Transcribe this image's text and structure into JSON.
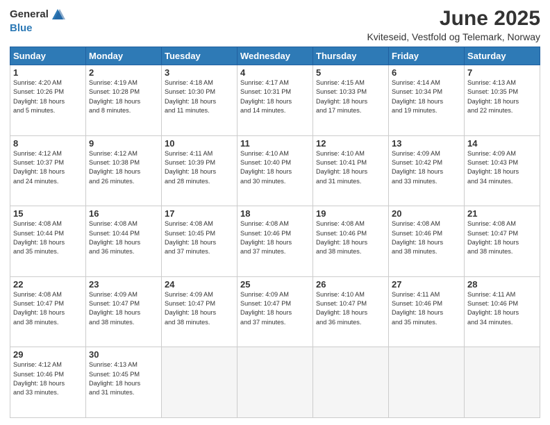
{
  "logo": {
    "general": "General",
    "blue": "Blue"
  },
  "title": "June 2025",
  "subtitle": "Kviteseid, Vestfold og Telemark, Norway",
  "weekdays": [
    "Sunday",
    "Monday",
    "Tuesday",
    "Wednesday",
    "Thursday",
    "Friday",
    "Saturday"
  ],
  "weeks": [
    [
      {
        "day": 1,
        "sunrise": "4:20 AM",
        "sunset": "10:26 PM",
        "daylight": "18 hours and 5 minutes."
      },
      {
        "day": 2,
        "sunrise": "4:19 AM",
        "sunset": "10:28 PM",
        "daylight": "18 hours and 8 minutes."
      },
      {
        "day": 3,
        "sunrise": "4:18 AM",
        "sunset": "10:30 PM",
        "daylight": "18 hours and 11 minutes."
      },
      {
        "day": 4,
        "sunrise": "4:17 AM",
        "sunset": "10:31 PM",
        "daylight": "18 hours and 14 minutes."
      },
      {
        "day": 5,
        "sunrise": "4:15 AM",
        "sunset": "10:33 PM",
        "daylight": "18 hours and 17 minutes."
      },
      {
        "day": 6,
        "sunrise": "4:14 AM",
        "sunset": "10:34 PM",
        "daylight": "18 hours and 19 minutes."
      },
      {
        "day": 7,
        "sunrise": "4:13 AM",
        "sunset": "10:35 PM",
        "daylight": "18 hours and 22 minutes."
      }
    ],
    [
      {
        "day": 8,
        "sunrise": "4:12 AM",
        "sunset": "10:37 PM",
        "daylight": "18 hours and 24 minutes."
      },
      {
        "day": 9,
        "sunrise": "4:12 AM",
        "sunset": "10:38 PM",
        "daylight": "18 hours and 26 minutes."
      },
      {
        "day": 10,
        "sunrise": "4:11 AM",
        "sunset": "10:39 PM",
        "daylight": "18 hours and 28 minutes."
      },
      {
        "day": 11,
        "sunrise": "4:10 AM",
        "sunset": "10:40 PM",
        "daylight": "18 hours and 30 minutes."
      },
      {
        "day": 12,
        "sunrise": "4:10 AM",
        "sunset": "10:41 PM",
        "daylight": "18 hours and 31 minutes."
      },
      {
        "day": 13,
        "sunrise": "4:09 AM",
        "sunset": "10:42 PM",
        "daylight": "18 hours and 33 minutes."
      },
      {
        "day": 14,
        "sunrise": "4:09 AM",
        "sunset": "10:43 PM",
        "daylight": "18 hours and 34 minutes."
      }
    ],
    [
      {
        "day": 15,
        "sunrise": "4:08 AM",
        "sunset": "10:44 PM",
        "daylight": "18 hours and 35 minutes."
      },
      {
        "day": 16,
        "sunrise": "4:08 AM",
        "sunset": "10:44 PM",
        "daylight": "18 hours and 36 minutes."
      },
      {
        "day": 17,
        "sunrise": "4:08 AM",
        "sunset": "10:45 PM",
        "daylight": "18 hours and 37 minutes."
      },
      {
        "day": 18,
        "sunrise": "4:08 AM",
        "sunset": "10:46 PM",
        "daylight": "18 hours and 37 minutes."
      },
      {
        "day": 19,
        "sunrise": "4:08 AM",
        "sunset": "10:46 PM",
        "daylight": "18 hours and 38 minutes."
      },
      {
        "day": 20,
        "sunrise": "4:08 AM",
        "sunset": "10:46 PM",
        "daylight": "18 hours and 38 minutes."
      },
      {
        "day": 21,
        "sunrise": "4:08 AM",
        "sunset": "10:47 PM",
        "daylight": "18 hours and 38 minutes."
      }
    ],
    [
      {
        "day": 22,
        "sunrise": "4:08 AM",
        "sunset": "10:47 PM",
        "daylight": "18 hours and 38 minutes."
      },
      {
        "day": 23,
        "sunrise": "4:09 AM",
        "sunset": "10:47 PM",
        "daylight": "18 hours and 38 minutes."
      },
      {
        "day": 24,
        "sunrise": "4:09 AM",
        "sunset": "10:47 PM",
        "daylight": "18 hours and 38 minutes."
      },
      {
        "day": 25,
        "sunrise": "4:09 AM",
        "sunset": "10:47 PM",
        "daylight": "18 hours and 37 minutes."
      },
      {
        "day": 26,
        "sunrise": "4:10 AM",
        "sunset": "10:47 PM",
        "daylight": "18 hours and 36 minutes."
      },
      {
        "day": 27,
        "sunrise": "4:11 AM",
        "sunset": "10:46 PM",
        "daylight": "18 hours and 35 minutes."
      },
      {
        "day": 28,
        "sunrise": "4:11 AM",
        "sunset": "10:46 PM",
        "daylight": "18 hours and 34 minutes."
      }
    ],
    [
      {
        "day": 29,
        "sunrise": "4:12 AM",
        "sunset": "10:46 PM",
        "daylight": "18 hours and 33 minutes."
      },
      {
        "day": 30,
        "sunrise": "4:13 AM",
        "sunset": "10:45 PM",
        "daylight": "18 hours and 31 minutes."
      },
      null,
      null,
      null,
      null,
      null
    ]
  ]
}
